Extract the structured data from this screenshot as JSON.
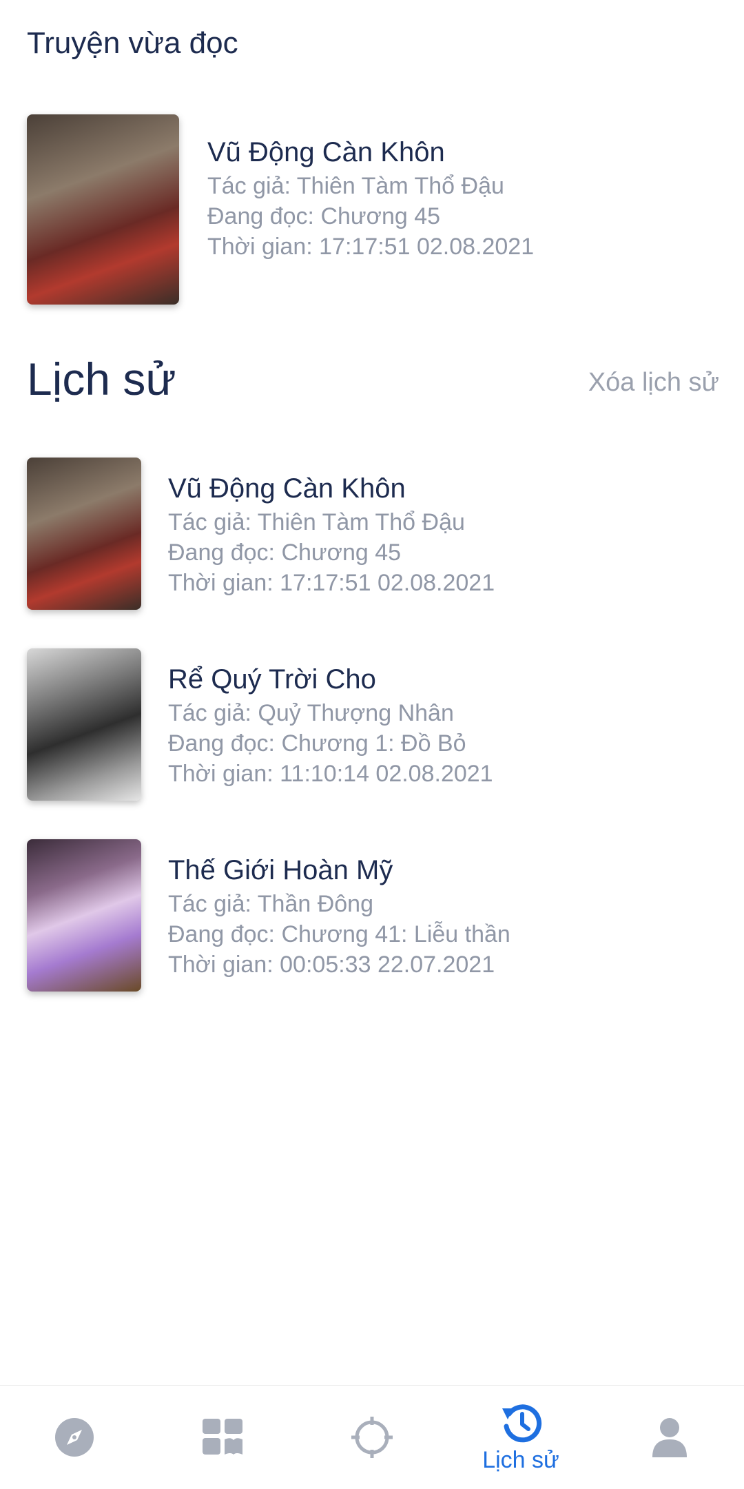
{
  "recent": {
    "heading": "Truyện vừa đọc",
    "title": "Vũ Động Càn Khôn",
    "author": "Tác giả: Thiên Tàm Thổ Đậu",
    "reading": "Đang đọc: Chương 45",
    "time": "Thời gian: 17:17:51 02.08.2021"
  },
  "history": {
    "heading": "Lịch sử",
    "clear_label": "Xóa lịch sử",
    "items": [
      {
        "title": "Vũ Động Càn Khôn",
        "author": "Tác giả: Thiên Tàm Thổ Đậu",
        "reading": "Đang đọc: Chương 45",
        "time": "Thời gian: 17:17:51 02.08.2021"
      },
      {
        "title": "Rể Quý Trời Cho",
        "author": "Tác giả: Quỷ Thượng Nhân",
        "reading": "Đang đọc: Chương 1: Đồ Bỏ",
        "time": "Thời gian: 11:10:14 02.08.2021"
      },
      {
        "title": "Thế Giới Hoàn Mỹ",
        "author": "Tác giả: Thần Đông",
        "reading": "Đang đọc: Chương 41: Liễu thần",
        "time": "Thời gian: 00:05:33 22.07.2021"
      }
    ]
  },
  "tabbar": {
    "active_label": "Lịch sử",
    "active_color": "#1e6fe0",
    "inactive_color": "#a9afbb",
    "icons": [
      "compass-icon",
      "library-icon",
      "crosshair-icon",
      "history-icon",
      "user-icon"
    ]
  }
}
